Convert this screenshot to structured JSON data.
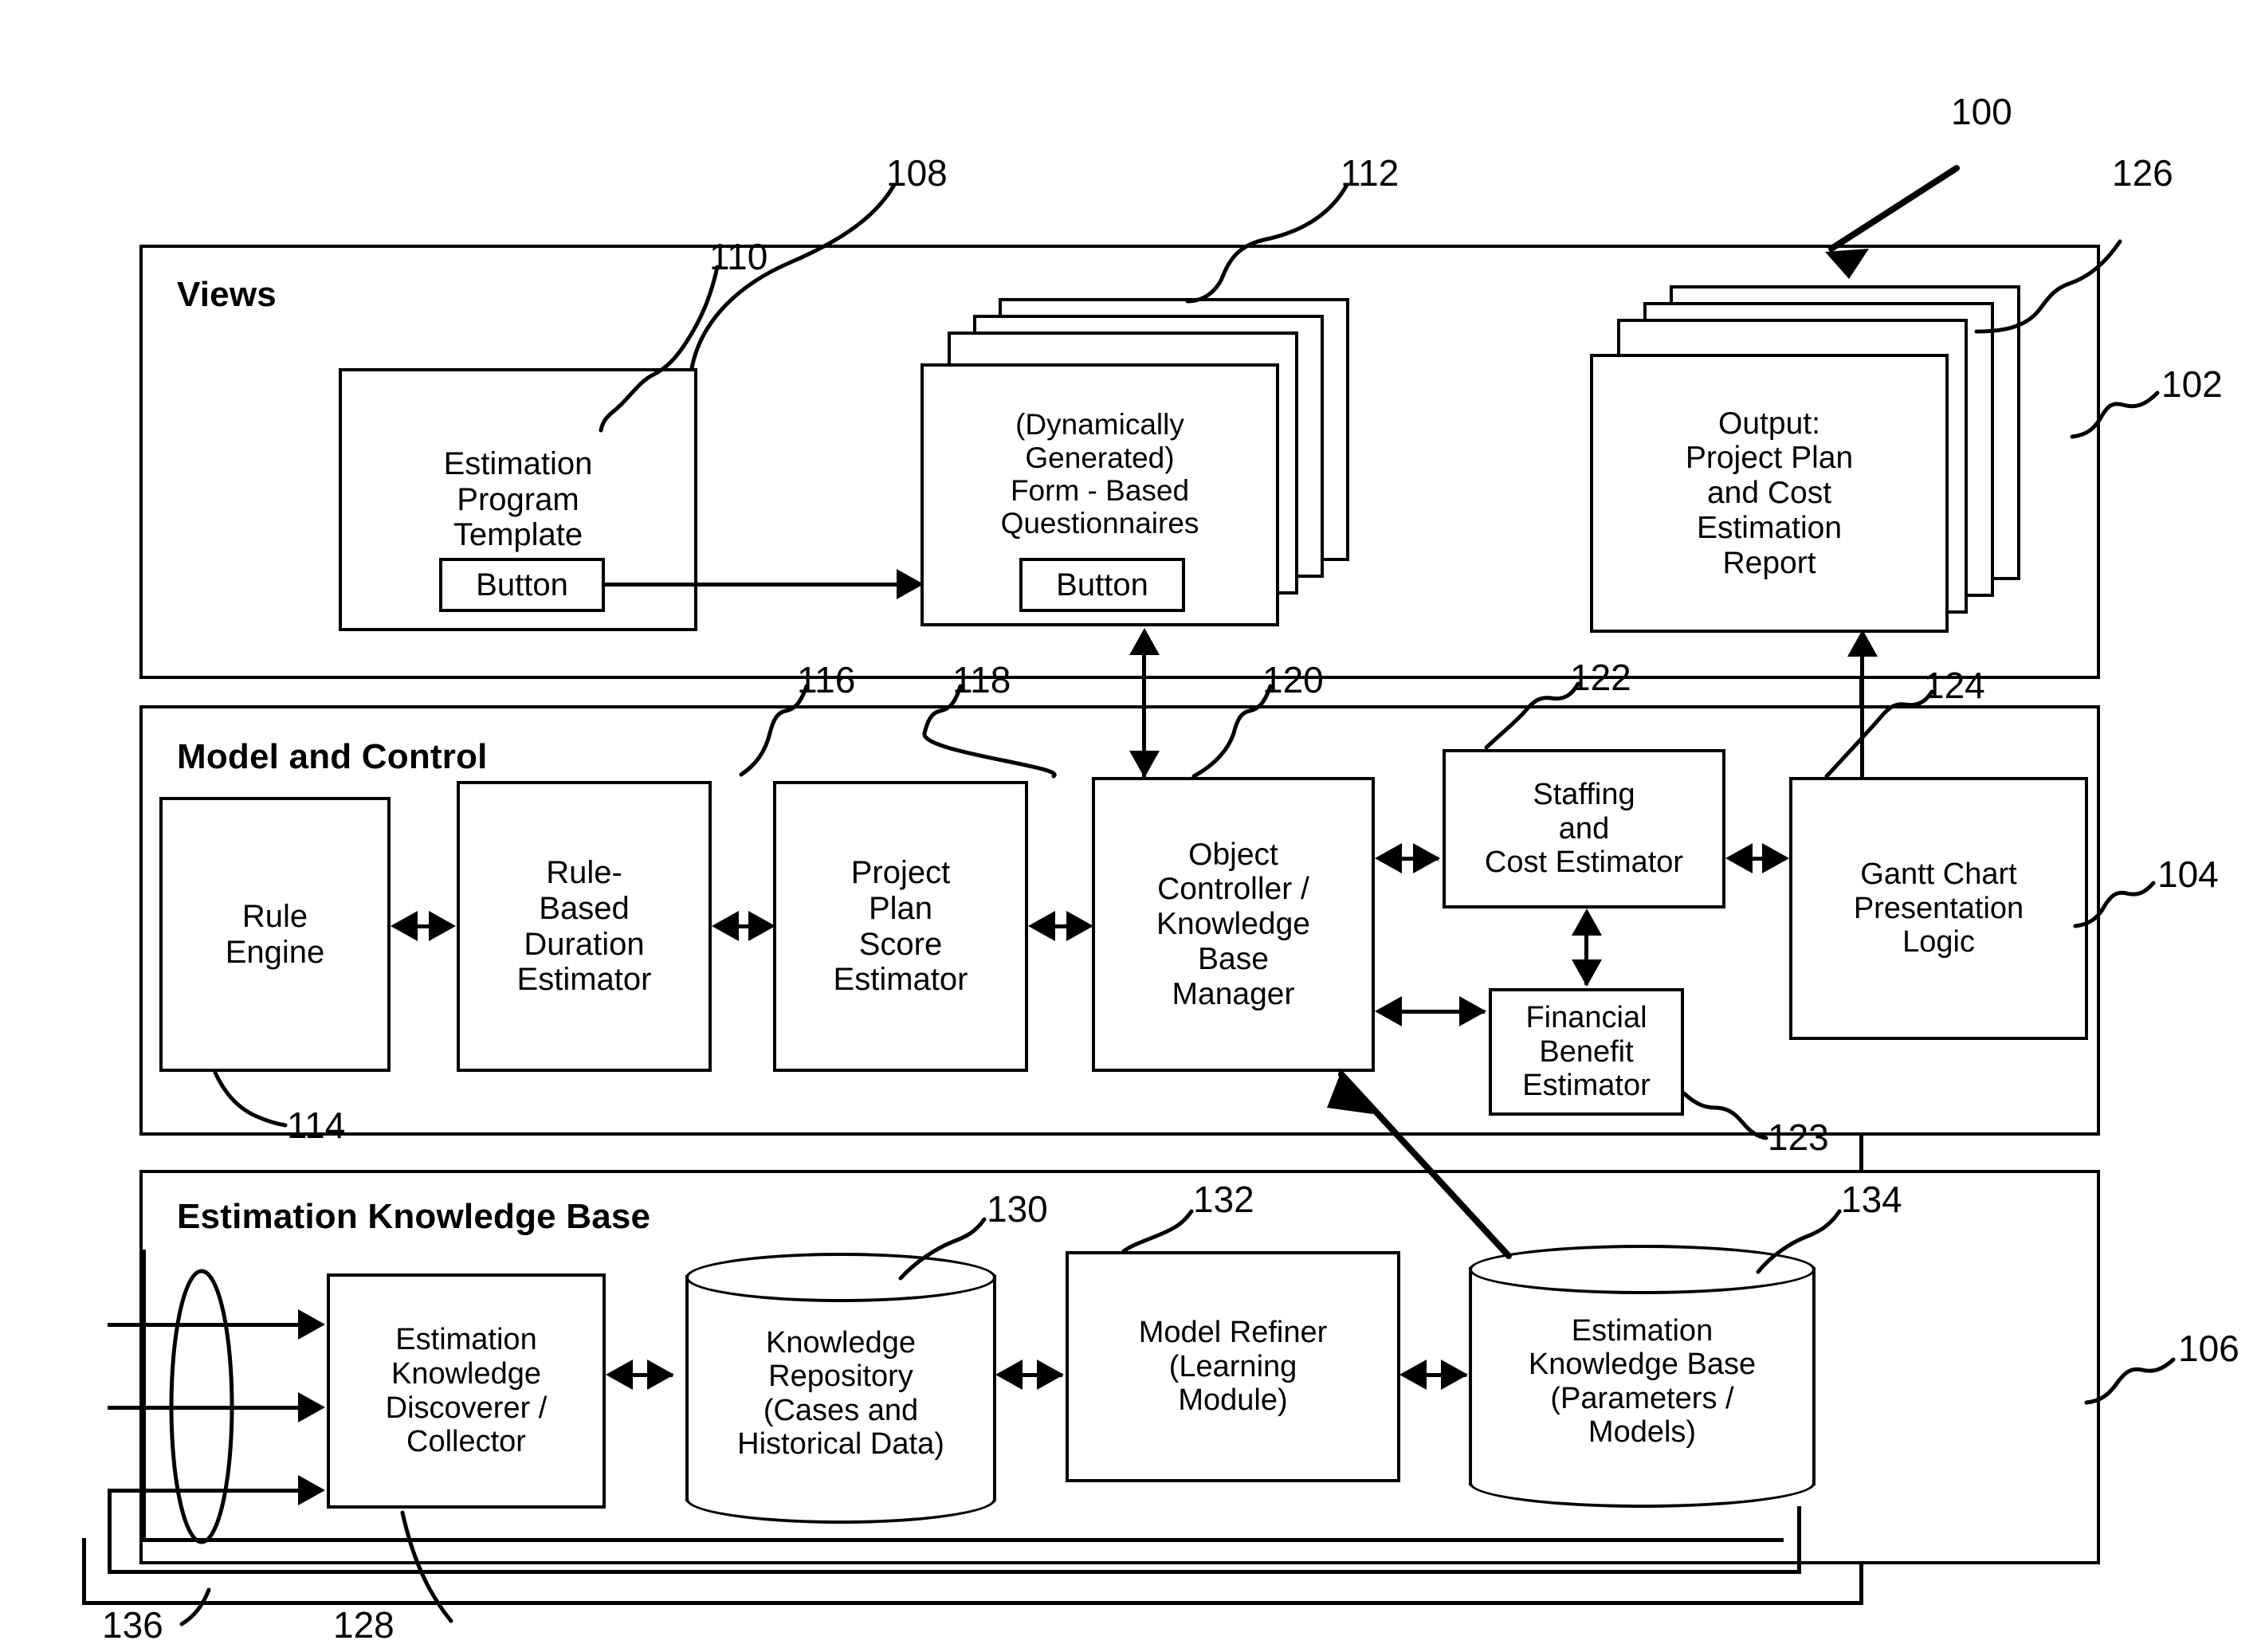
{
  "figure": {
    "reference_numeral": "100",
    "panels": [
      {
        "id": "views",
        "title": "Views",
        "ref": "102"
      },
      {
        "id": "model",
        "title": "Model and Control",
        "ref": "104"
      },
      {
        "id": "kb",
        "title": "Estimation Knowledge Base",
        "ref": "106"
      }
    ]
  },
  "views": {
    "template_box": {
      "line1": "Estimation",
      "line2": "Program",
      "line3": "Template",
      "button_label": "Button",
      "ref_box": "108",
      "ref_button": "110"
    },
    "questionnaire_box": {
      "line1": "(Dynamically",
      "line2": "Generated)",
      "line3": "Form  -  Based",
      "line4": "Questionnaires",
      "button_label": "Button",
      "ref": "112",
      "stack_count": 4
    },
    "output_box": {
      "line1": "Output:",
      "line2": "Project Plan",
      "line3": "and Cost",
      "line4": "Estimation",
      "line5": "Report",
      "ref": "126",
      "stack_count": 4
    }
  },
  "model": {
    "rule_engine": {
      "line1": "Rule",
      "line2": "Engine",
      "ref": "114"
    },
    "duration_estimator": {
      "line1": "Rule-",
      "line2": "Based",
      "line3": "Duration",
      "line4": "Estimator",
      "ref": "116"
    },
    "score_estimator": {
      "line1": "Project",
      "line2": "Plan",
      "line3": "Score",
      "line4": "Estimator",
      "ref": "118"
    },
    "object_controller": {
      "line1": "Object",
      "line2": "Controller /",
      "line3": "Knowledge",
      "line4": "Base",
      "line5": "Manager",
      "ref": "120"
    },
    "staffing_estimator": {
      "line1": "Staffing",
      "line2": "and",
      "line3": "Cost Estimator",
      "ref": "122"
    },
    "financial_estimator": {
      "line1": "Financial",
      "line2": "Benefit",
      "line3": "Estimator",
      "ref": "123"
    },
    "gantt_logic": {
      "line1": "Gantt Chart",
      "line2": "Presentation",
      "line3": "Logic",
      "ref": "124"
    }
  },
  "knowledge_base": {
    "discoverer": {
      "line1": "Estimation",
      "line2": "Knowledge",
      "line3": "Discoverer /",
      "line4": "Collector",
      "ref": "128"
    },
    "repository": {
      "line1": "Knowledge",
      "line2": "Repository",
      "line3": "(Cases and",
      "line4": "Historical Data)",
      "ref": "130",
      "shape": "cylinder"
    },
    "model_refiner": {
      "line1": "Model  Refiner",
      "line2": "(Learning",
      "line3": "Module)",
      "ref": "132"
    },
    "est_kb": {
      "line1": "Estimation",
      "line2": "Knowledge Base",
      "line3": "(Parameters /",
      "line4": "Models)",
      "ref": "134",
      "shape": "cylinder"
    },
    "inputs": {
      "ref": "136",
      "arrow_count": 3
    }
  },
  "colors": {
    "stroke": "#000000",
    "fill": "#ffffff"
  }
}
